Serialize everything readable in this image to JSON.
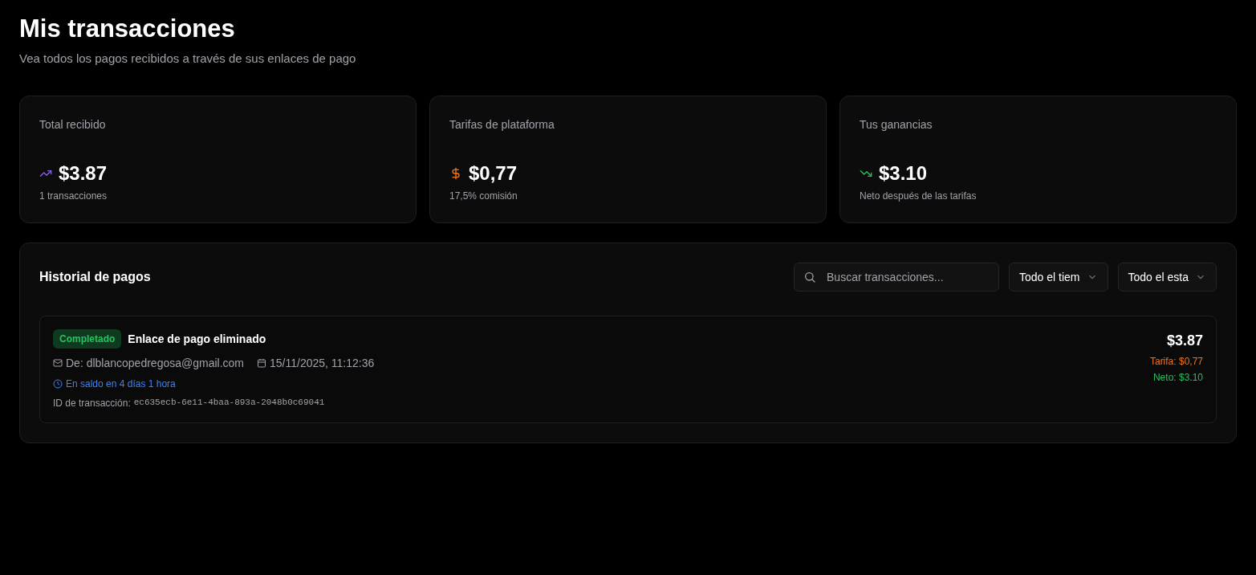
{
  "header": {
    "title": "Mis transacciones",
    "subtitle": "Vea todos los pagos recibidos a través de sus enlaces de pago"
  },
  "stats": [
    {
      "label": "Total recibido",
      "kind": "trend-up",
      "value": "$3.87",
      "note": "1 transacciones"
    },
    {
      "label": "Tarifas de plataforma",
      "kind": "dollar",
      "value": "$0,77",
      "note": "17,5% comisión"
    },
    {
      "label": "Tus ganancias",
      "kind": "trend-down",
      "value": "$3.10",
      "note": "Neto después de las tarifas"
    }
  ],
  "history": {
    "title": "Historial de pagos",
    "search": {
      "placeholder": "Buscar transacciones..."
    },
    "filters": [
      "Todo el tiem",
      "Todo el esta"
    ],
    "transactions": [
      {
        "status": "Completado",
        "kind": "completed",
        "title": "Enlace de pago eliminado",
        "from": "De: dlblancopedregosa@gmail.com",
        "date": "15/11/2025, 11:12:36",
        "pending": "En saldo en 4 días 1 hora",
        "id_label": "ID de transacción:",
        "id": "ec635ecb-6e11-4baa-893a-2048b0c69041",
        "amount": "$3.87",
        "fee": "Tarifa: $0,77",
        "net": "Neto: $3.10"
      }
    ]
  }
}
